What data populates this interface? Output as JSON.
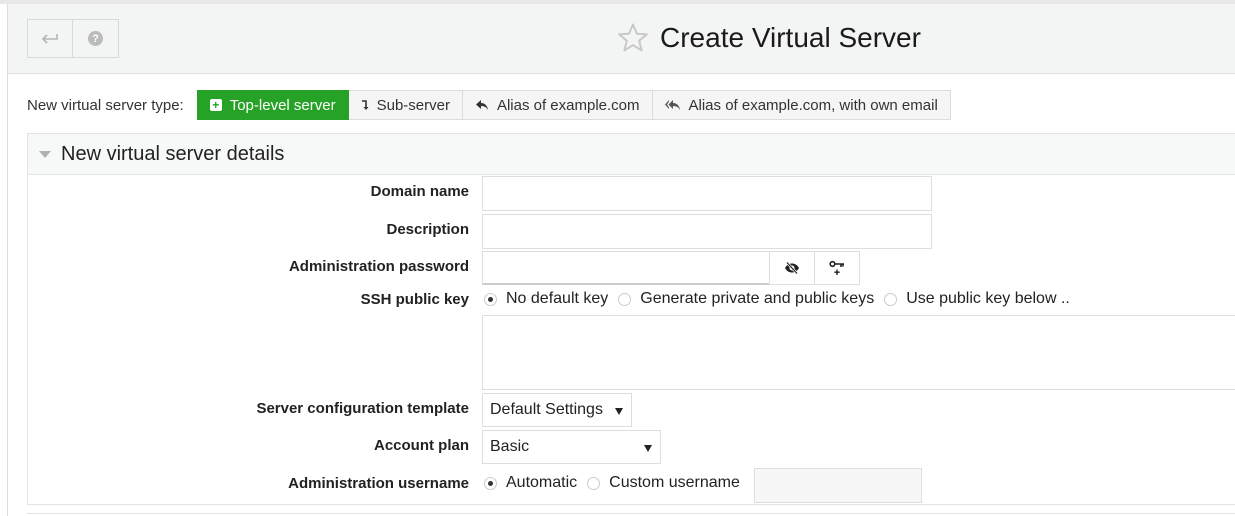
{
  "header": {
    "back_icon": "return-arrow-icon",
    "help_icon": "question-circle-icon",
    "favorite_icon": "star-outline-icon",
    "title": "Create Virtual Server"
  },
  "server_type": {
    "label": "New virtual server type:",
    "options": [
      {
        "label": "Top-level server",
        "icon": "plus-square-icon",
        "active": true
      },
      {
        "label": "Sub-server",
        "icon": "arrow-down-turn-icon",
        "active": false
      },
      {
        "label": "Alias of example.com",
        "icon": "reply-icon",
        "active": false
      },
      {
        "label": "Alias of example.com, with own email",
        "icon": "reply-all-icon",
        "active": false
      }
    ],
    "active_color": "#26a326"
  },
  "section": {
    "title": "New virtual server details",
    "fields": {
      "domain_name": {
        "label": "Domain name",
        "value": ""
      },
      "description": {
        "label": "Description",
        "value": ""
      },
      "admin_password": {
        "label": "Administration password",
        "value": "",
        "toggle_icon": "eye-slash-icon",
        "generate_icon": "key-plus-icon"
      },
      "ssh_key": {
        "label": "SSH public key",
        "options": [
          "No default key",
          "Generate private and public keys",
          "Use public key below .."
        ],
        "selected": 0,
        "value": ""
      },
      "config_template": {
        "label": "Server configuration template",
        "selected": "Default Settings"
      },
      "account_plan": {
        "label": "Account plan",
        "selected": "Basic"
      },
      "admin_username": {
        "label": "Administration username",
        "options": [
          "Automatic",
          "Custom username"
        ],
        "selected": 0,
        "value": ""
      }
    }
  }
}
